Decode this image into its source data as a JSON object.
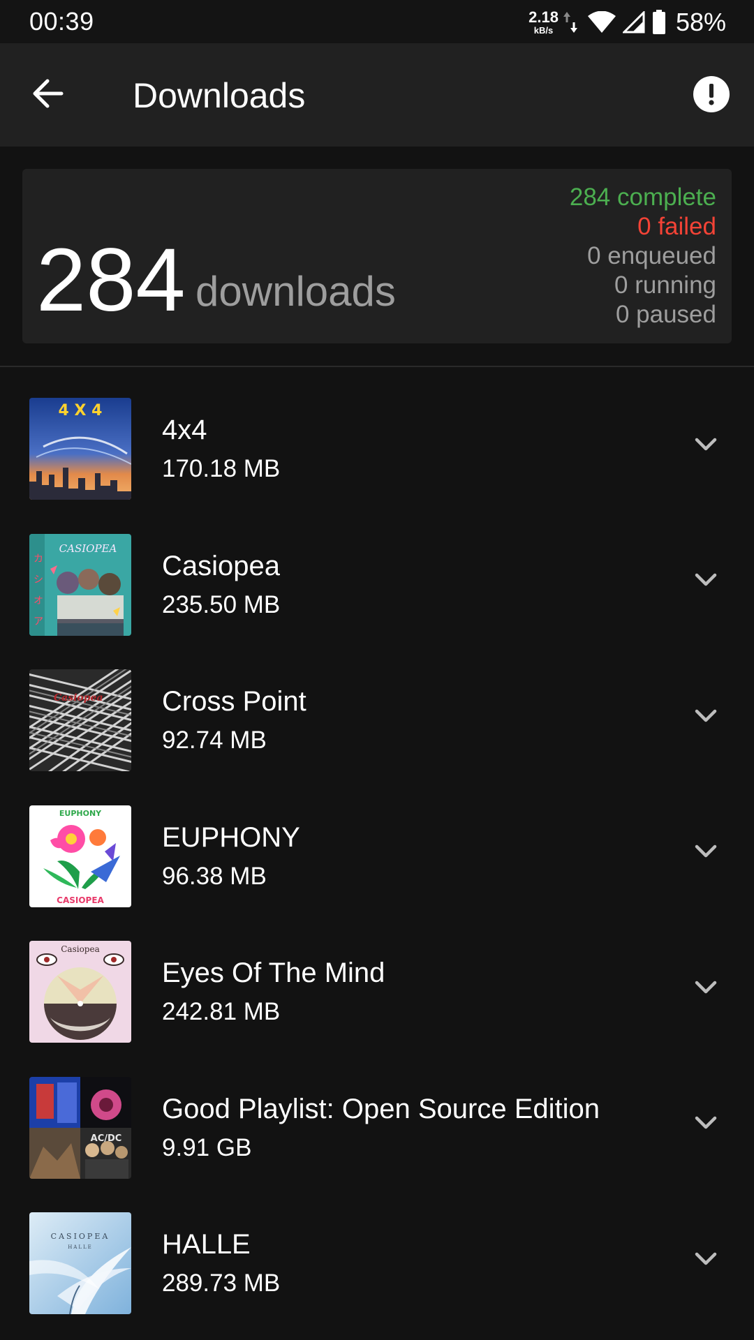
{
  "status_bar": {
    "time": "00:39",
    "net_speed_value": "2.18",
    "net_speed_unit": "kB/s",
    "battery_percent": "58%",
    "icons": [
      "data-transfer-icon",
      "wifi-icon",
      "cell-signal-icon",
      "battery-icon"
    ]
  },
  "app_bar": {
    "title": "Downloads",
    "back_icon": "arrow-back-icon",
    "action_icon": "alert-circle-icon"
  },
  "summary": {
    "count": "284",
    "unit_label": "downloads",
    "complete": "284 complete",
    "failed": "0 failed",
    "enqueued": "0 enqueued",
    "running": "0 running",
    "paused": "0 paused",
    "colors": {
      "complete": "#4caf50",
      "failed": "#f44336",
      "neutral": "#9e9e9e"
    }
  },
  "downloads": [
    {
      "title": "4x4",
      "size": "170.18 MB",
      "cover_text": "4 X 4"
    },
    {
      "title": "Casiopea",
      "size": "235.50 MB",
      "cover_text": "CASIOPEA"
    },
    {
      "title": "Cross Point",
      "size": "92.74 MB",
      "cover_text": ""
    },
    {
      "title": "EUPHONY",
      "size": "96.38 MB",
      "cover_text": "EUPHONY"
    },
    {
      "title": "Eyes Of The Mind",
      "size": "242.81 MB",
      "cover_text": "Casiopea"
    },
    {
      "title": "Good Playlist: Open Source Edition",
      "size": "9.91 GB",
      "cover_text": ""
    },
    {
      "title": "HALLE",
      "size": "289.73 MB",
      "cover_text": "CASIOPEA"
    }
  ]
}
